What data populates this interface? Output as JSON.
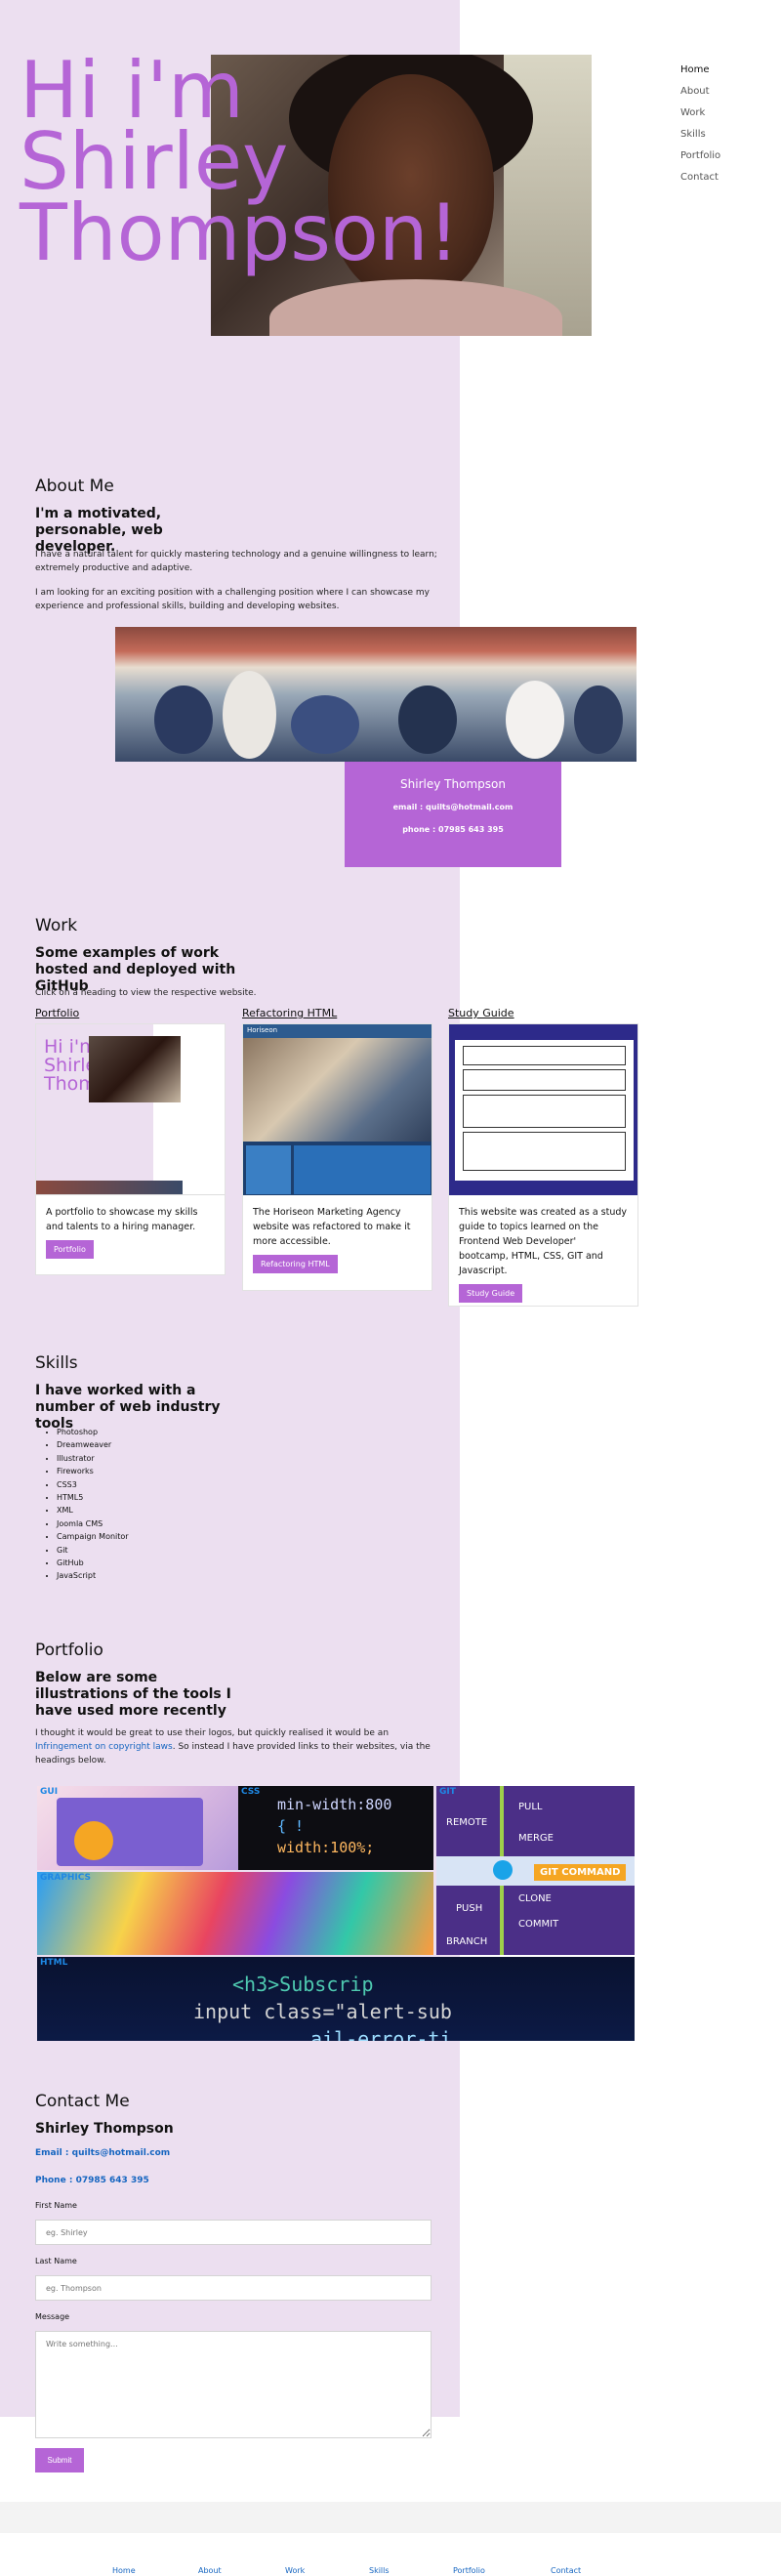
{
  "hero": {
    "line1": "Hi i'm",
    "line2": "Shirley",
    "line3": "Thompson!"
  },
  "nav": [
    "Home",
    "About",
    "Work",
    "Skills",
    "Portfolio",
    "Contact"
  ],
  "about": {
    "title": "About Me",
    "subtitle": "I'm a motivated, personable, web developer.",
    "p1": "I have a natural talent for quickly mastering technology and a genuine willingness to learn; extremely productive and adaptive.",
    "p2": "I am looking for an exciting position with a challenging position where I can showcase my experience and professional skills, building and developing websites.",
    "card_name": "Shirley Thompson",
    "card_email": "email : quilts@hotmail.com",
    "card_phone": "phone : 07985 643 395"
  },
  "work": {
    "title": "Work",
    "subtitle": "Some examples of work hosted and deployed with GitHub",
    "intro": "Click on a heading to view the respective website.",
    "cards": [
      {
        "heading": "Portfolio",
        "text": "A portfolio to showcase my skills and talents to a hiring manager.",
        "button": "Portfolio"
      },
      {
        "heading": "Refactoring HTML",
        "text": "The Horiseon Marketing Agency website was refactored to make it more accessible.",
        "button": "Refactoring HTML"
      },
      {
        "heading": "Study Guide",
        "text": "This website was created as a study guide to topics learned on the Frontend Web Developer' bootcamp, HTML, CSS, GIT and Javascript.",
        "button": "Study Guide"
      }
    ]
  },
  "skills": {
    "title": "Skills",
    "subtitle": "I have worked with a number of web industry tools",
    "items": [
      "Photoshop",
      "Dreamweaver",
      "Illustrator",
      "Fireworks",
      "CSS3",
      "HTML5",
      "XML",
      "Joomla CMS",
      "Campaign Monitor",
      "Git",
      "GitHub",
      "JavaScript"
    ]
  },
  "portfolio": {
    "title": "Portfolio",
    "subtitle": "Below are some illustrations of the tools I have used more recently",
    "p_before": "I thought it would be great to use their logos, but quickly realised it would be an ",
    "p_link": "Infringement on copyright laws",
    "p_after": ". So instead I have provided links to their websites, via the headings below.",
    "tiles": [
      "GUI",
      "CSS",
      "GIT",
      "GRAPHICS",
      "HTML"
    ],
    "git_words": [
      "REMOTE",
      "PULL",
      "MERGE",
      "GIT COMMAND",
      "PUSH",
      "CLONE",
      "COMMIT",
      "BRANCH"
    ],
    "css_code": [
      "min-width:800",
      "{ !",
      "width:100%;"
    ],
    "html_code": [
      "<h3>Subscrip",
      "input class=\"alert-sub",
      "ail-error-ti"
    ]
  },
  "contact": {
    "title": "Contact Me",
    "name": "Shirley Thompson",
    "email_label": "Email : ",
    "email": "quilts@hotmail.com",
    "phone_label": "Phone : ",
    "phone": "07985 643 395",
    "first_label": "First Name",
    "first_placeholder": "eg. Shirley",
    "last_label": "Last Name",
    "last_placeholder": "eg. Thompson",
    "message_label": "Message",
    "message_placeholder": "Write something...",
    "submit": "Submit"
  },
  "footer": [
    "Home",
    "About",
    "Work",
    "Skills",
    "Portfolio",
    "Contact"
  ],
  "colors": {
    "accent": "#b565d6",
    "background_band": "#ecdff0",
    "link": "#1565c0"
  }
}
